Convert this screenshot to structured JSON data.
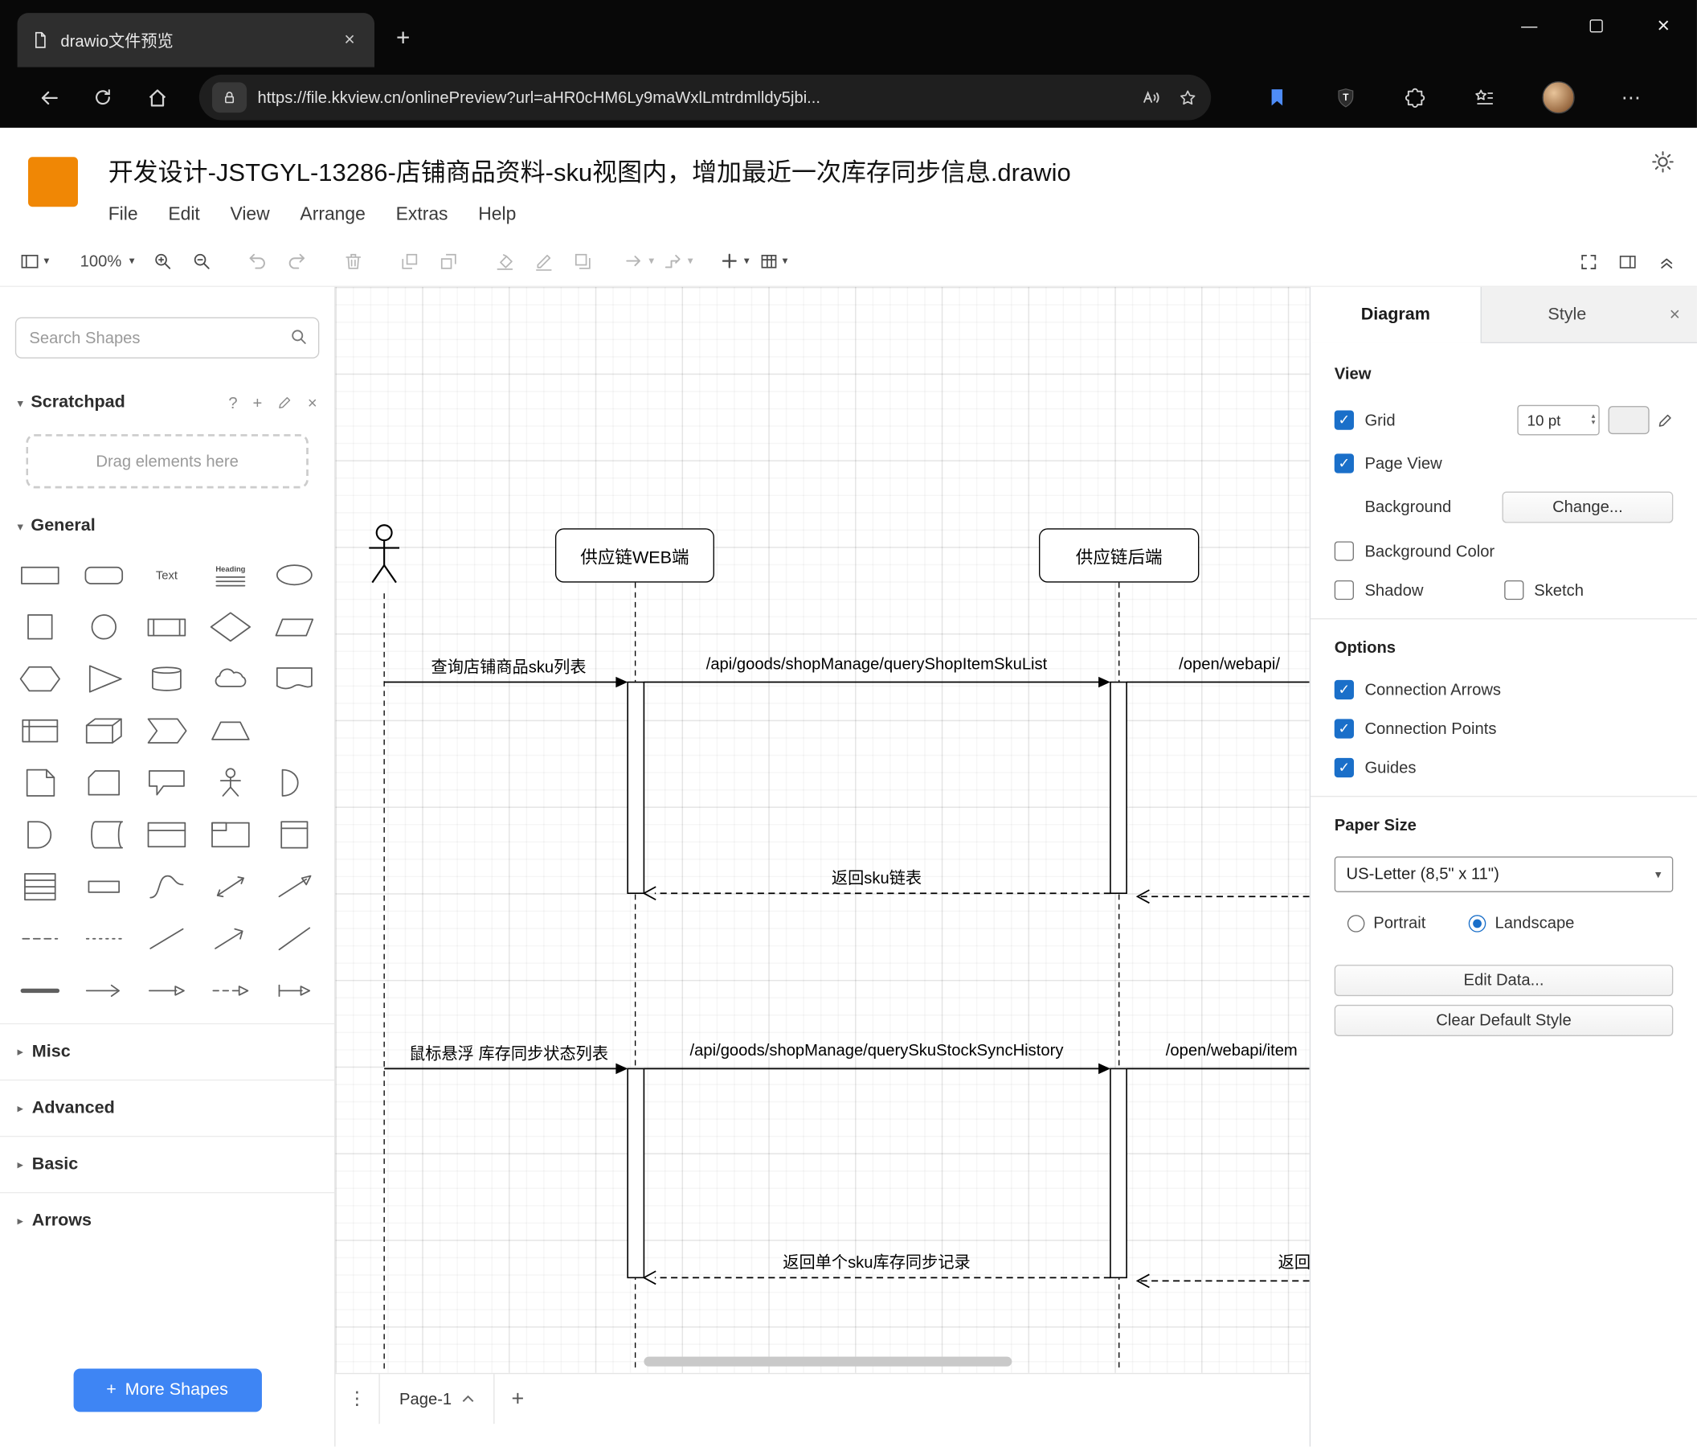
{
  "colors": {
    "accent_blue": "#1a6fc9",
    "drawio_orange": "#f08705",
    "more_shapes_blue": "#3e85f4"
  },
  "browser": {
    "tab_title": "drawio文件预览",
    "url": "https://file.kkview.cn/onlinePreview?url=aHR0cHM6Ly9maWxlLmtrdmlldy5jbi...",
    "shield_letter": "T"
  },
  "app": {
    "title": "开发设计-JSTGYL-13286-店铺商品资料-sku视图内，增加最近一次库存同步信息.drawio",
    "menus": [
      "File",
      "Edit",
      "View",
      "Arrange",
      "Extras",
      "Help"
    ],
    "toolbar": {
      "zoom": "100%"
    }
  },
  "sidebar": {
    "search_placeholder": "Search Shapes",
    "scratchpad": {
      "label": "Scratchpad",
      "hint": "Drag elements here"
    },
    "sections": [
      {
        "label": "General",
        "expanded": true
      },
      {
        "label": "Misc",
        "expanded": false
      },
      {
        "label": "Advanced",
        "expanded": false
      },
      {
        "label": "Basic",
        "expanded": false
      },
      {
        "label": "Arrows",
        "expanded": false
      }
    ],
    "shapes": [
      "rectangle",
      "rounded-rectangle",
      "text",
      "heading",
      "ellipse",
      "square",
      "circle",
      "process",
      "diamond",
      "parallelogram",
      "hexagon",
      "triangle",
      "cylinder",
      "cloud",
      "document",
      "internal-storage",
      "cube",
      "step",
      "trapezoid",
      "tape",
      "note",
      "card",
      "callout",
      "actor",
      "or",
      "and",
      "data-storage",
      "container",
      "container-title",
      "vertical-container",
      "list",
      "list-item",
      "curve",
      "bidirectional-arrow",
      "arrow",
      "dashed-line",
      "dotted-line",
      "line",
      "diagonal-arrow",
      "diagonal-line",
      "thick-line",
      "thin-arrow",
      "directional-connector",
      "dashed-connector",
      "arrow-connector"
    ],
    "more_shapes_label": "More Shapes"
  },
  "canvas": {
    "page_tab": "Page-1",
    "diagram": {
      "lifelines": [
        {
          "label": "供应链WEB端"
        },
        {
          "label": "供应链后端"
        }
      ],
      "messages": [
        {
          "text": "查询店铺商品sku列表",
          "type": "solid"
        },
        {
          "text": "/api/goods/shopManage/queryShopItemSkuList",
          "type": "solid"
        },
        {
          "text": "/open/webapi/",
          "type": "solid"
        },
        {
          "text": "返回sku链表",
          "type": "return"
        },
        {
          "text": "鼠标悬浮 库存同步状态列表",
          "type": "solid"
        },
        {
          "text": "/api/goods/shopManage/querySkuStockSyncHistory",
          "type": "solid"
        },
        {
          "text": "/open/webapi/item",
          "type": "solid"
        },
        {
          "text": "返回单个sku库存同步记录",
          "type": "return"
        },
        {
          "text": "返回",
          "type": "return"
        }
      ]
    }
  },
  "format_panel": {
    "tabs": [
      {
        "label": "Diagram",
        "active": true
      },
      {
        "label": "Style",
        "active": false
      }
    ],
    "view": {
      "heading": "View",
      "grid_label": "Grid",
      "grid_checked": true,
      "grid_size": "10 pt",
      "page_view_label": "Page View",
      "page_view_checked": true,
      "background_label": "Background",
      "background_button": "Change...",
      "background_color_label": "Background Color",
      "background_color_checked": false,
      "shadow_label": "Shadow",
      "shadow_checked": false,
      "sketch_label": "Sketch",
      "sketch_checked": false
    },
    "options": {
      "heading": "Options",
      "items": [
        {
          "label": "Connection Arrows",
          "checked": true
        },
        {
          "label": "Connection Points",
          "checked": true
        },
        {
          "label": "Guides",
          "checked": true
        }
      ]
    },
    "paper": {
      "heading": "Paper Size",
      "selected": "US-Letter (8,5\" x 11\")",
      "orientations": [
        {
          "label": "Portrait",
          "selected": false
        },
        {
          "label": "Landscape",
          "selected": true
        }
      ]
    },
    "buttons": [
      {
        "label": "Edit Data..."
      },
      {
        "label": "Clear Default Style"
      }
    ]
  }
}
